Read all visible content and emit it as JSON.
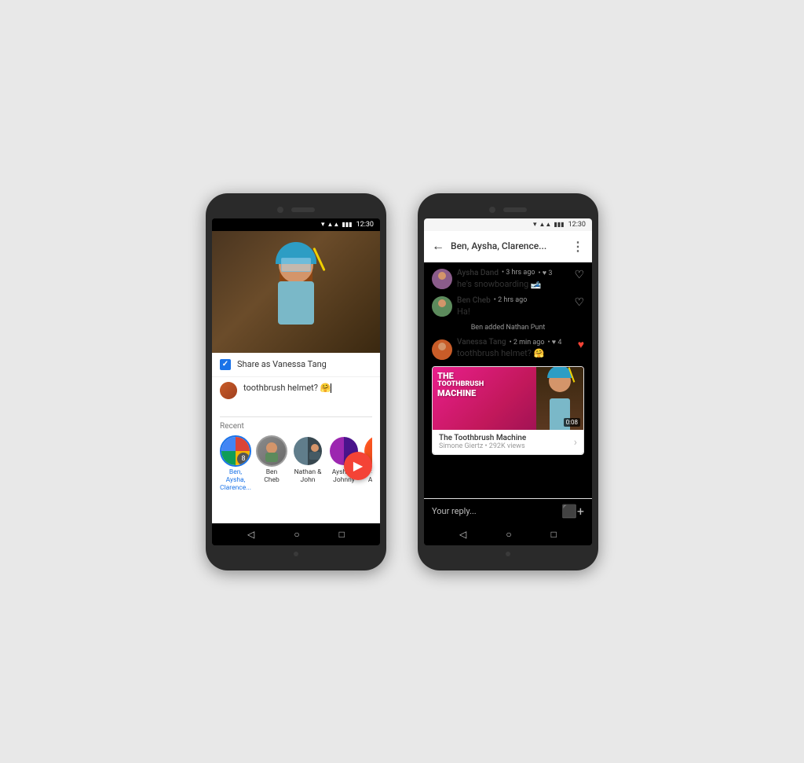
{
  "phone1": {
    "status_bar": {
      "time": "12:30"
    },
    "share_as": "Share as Vanessa Tang",
    "message_text": "toothbrush helmet? 🤗",
    "recent_label": "Recent",
    "contacts": [
      {
        "id": "ben-aysha-clarence",
        "name": "Ben, Aysha, Clarence...",
        "badge": "8",
        "selected": true,
        "multi": true
      },
      {
        "id": "ben-cheb",
        "name": "Ben Cheb",
        "selected": false,
        "color": "av-gray"
      },
      {
        "id": "nathan-john",
        "name": "Nathan & John",
        "selected": false,
        "color": "av-blue"
      },
      {
        "id": "aysha-johnny",
        "name": "Aysha & Johnny",
        "selected": false,
        "color": "av-pink"
      },
      {
        "id": "stace-alejan",
        "name": "Stace Alejan...",
        "selected": false,
        "color": "av-purple"
      }
    ],
    "nav": {
      "back": "◁",
      "home": "○",
      "square": "□"
    }
  },
  "phone2": {
    "status_bar": {
      "time": "12:30"
    },
    "header": {
      "back": "←",
      "title": "Ben, Aysha, Clarence...",
      "more": "⋮"
    },
    "messages": [
      {
        "id": "msg-aysha",
        "author": "Aysha Dand",
        "time": "3 hrs ago",
        "likes": "3",
        "text": "he's snowboarding 🎿",
        "avatar_color": "av-aysha",
        "liked": false,
        "partial": true
      },
      {
        "id": "msg-ben",
        "author": "Ben Cheb",
        "time": "2 hrs ago",
        "text": "Ha!",
        "avatar_color": "av-ben",
        "liked": false,
        "likes": ""
      },
      {
        "id": "system",
        "type": "system",
        "text": "Ben added Nathan Punt"
      },
      {
        "id": "msg-vanessa",
        "author": "Vanessa Tang",
        "time": "2 min ago",
        "likes": "4",
        "text": "toothbrush helmet? 🤗",
        "avatar_color": "av-vanessa",
        "liked": true
      }
    ],
    "video_card": {
      "title_line1": "THE",
      "title_line2": "TOOTHBRUSH",
      "title_line3": "MACHINE",
      "duration": "0:08",
      "video_title": "The Toothbrush Machine",
      "channel": "Simone Giertz • 292K views"
    },
    "reply_placeholder": "Your reply...",
    "nav": {
      "back": "◁",
      "home": "○",
      "square": "□"
    }
  }
}
